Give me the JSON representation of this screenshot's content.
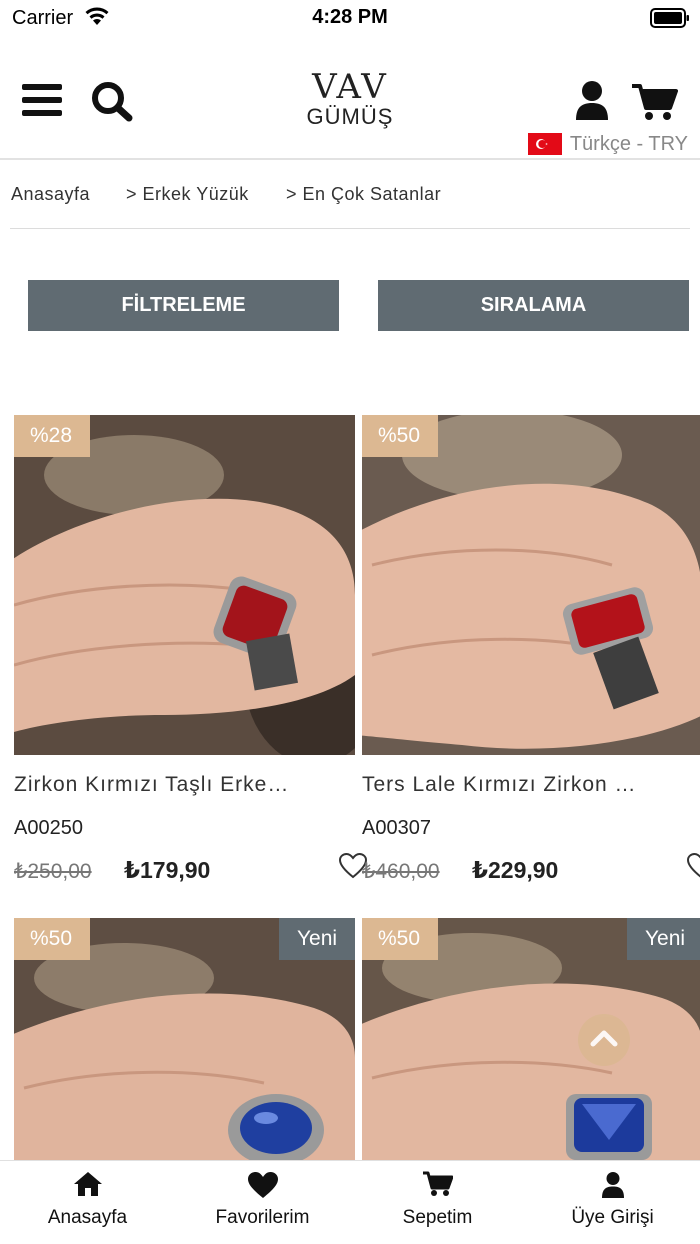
{
  "status_bar": {
    "carrier": "Carrier",
    "time": "4:28 PM"
  },
  "header": {
    "logo_mark": "VAV",
    "logo_text": "GÜMÜŞ",
    "language": "Türkçe - TRY"
  },
  "breadcrumb": [
    {
      "label": "Anasayfa"
    },
    {
      "label": "> Erkek Yüzük"
    },
    {
      "label": "> En Çok Satanlar"
    }
  ],
  "actions": {
    "filter_label": "FİLTRELEME",
    "sort_label": "SIRALAMA"
  },
  "products": [
    {
      "discount": "%28",
      "new_badge": "",
      "name": "Zirkon Kırmızı Taşlı Erke…",
      "code": "A00250",
      "old_price": "₺250,00",
      "new_price": "₺179,90",
      "stone_color": "#a3141b"
    },
    {
      "discount": "%50",
      "new_badge": "",
      "name": "Ters Lale Kırmızı Zirkon …",
      "code": "A00307",
      "old_price": "₺460,00",
      "new_price": "₺229,90",
      "stone_color": "#b3121a"
    },
    {
      "discount": "%50",
      "new_badge": "Yeni",
      "stone_color": "#1f3fa0"
    },
    {
      "discount": "%50",
      "new_badge": "Yeni",
      "stone_color": "#1c3a9c"
    }
  ],
  "bottom_nav": [
    {
      "label": "Anasayfa",
      "icon": "home-icon"
    },
    {
      "label": "Favorilerim",
      "icon": "heart-icon"
    },
    {
      "label": "Sepetim",
      "icon": "cart-icon"
    },
    {
      "label": "Üye Girişi",
      "icon": "user-icon"
    }
  ],
  "colors": {
    "accent": "#dcb892",
    "button": "#606b72"
  }
}
